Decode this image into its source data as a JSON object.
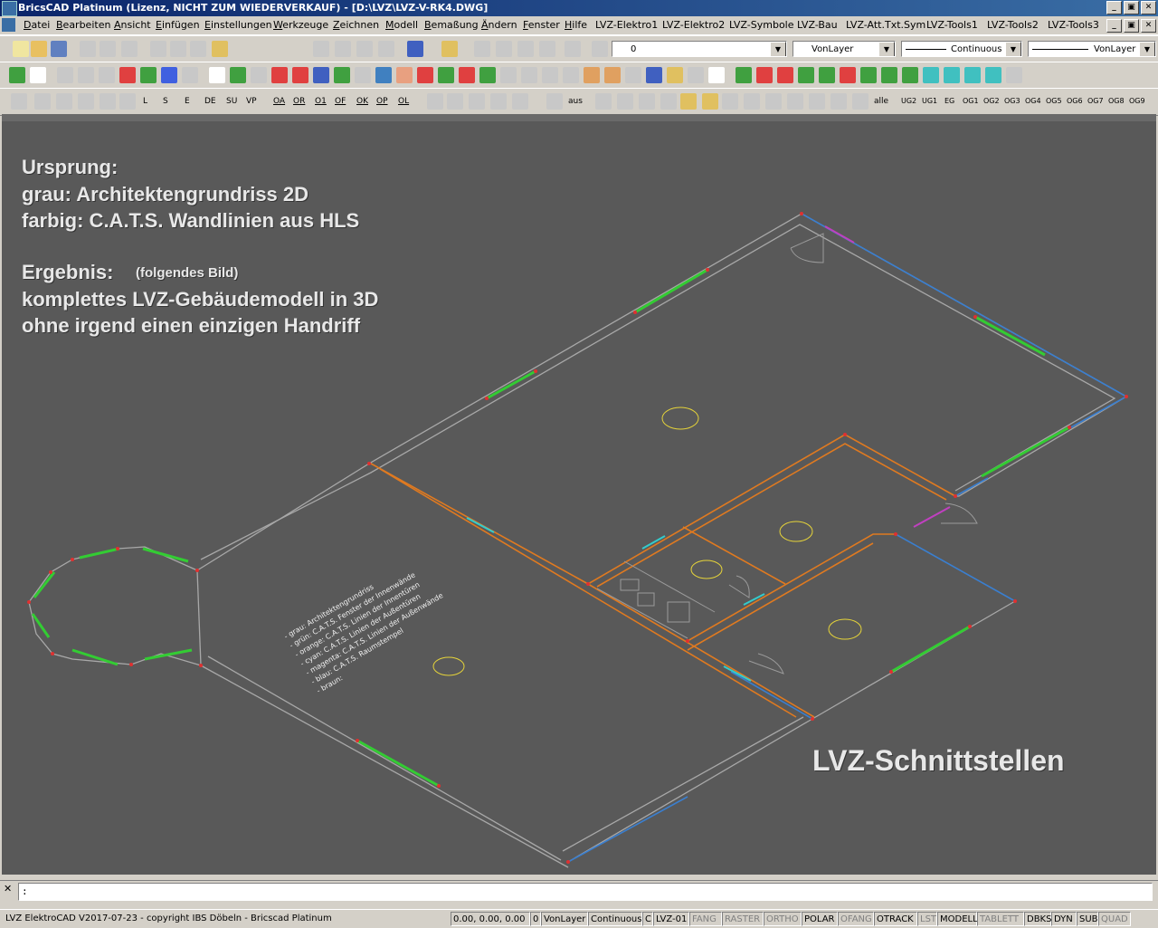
{
  "window": {
    "title": "BricsCAD Platinum (Lizenz, NICHT ZUM WIEDERVERKAUF) - [D:\\LVZ\\LVZ-V-RK4.DWG]"
  },
  "window_buttons": [
    "_",
    "▣",
    "✕"
  ],
  "menu": {
    "items": [
      {
        "u": "D",
        "rest": "atei"
      },
      {
        "u": "B",
        "rest": "earbeiten"
      },
      {
        "u": "A",
        "rest": "nsicht"
      },
      {
        "u": "E",
        "rest": "infügen"
      },
      {
        "u": "E",
        "rest": "instellungen"
      },
      {
        "u": "W",
        "rest": "erkzeuge"
      },
      {
        "u": "Z",
        "rest": "eichnen"
      },
      {
        "u": "M",
        "rest": "odell"
      },
      {
        "u": "B",
        "rest": "emaßung"
      },
      {
        "u": "Ä",
        "rest": "ndern"
      },
      {
        "u": "F",
        "rest": "enster"
      },
      {
        "u": "H",
        "rest": "ilfe"
      },
      {
        "u": "",
        "rest": "LVZ-Elektro1"
      },
      {
        "u": "",
        "rest": "LVZ-Elektro2"
      },
      {
        "u": "",
        "rest": "LVZ-Symbole"
      },
      {
        "u": "",
        "rest": "LVZ-Bau"
      },
      {
        "u": "",
        "rest": "LVZ-Att.Txt.Sym"
      },
      {
        "u": "",
        "rest": "LVZ-Tools1"
      },
      {
        "u": "",
        "rest": "LVZ-Tools2"
      },
      {
        "u": "",
        "rest": "LVZ-Tools3"
      }
    ]
  },
  "toolbar1": {
    "layer_value": "0",
    "color_value": "VonLayer",
    "linetype_value": "Continuous",
    "lineweight_value": "VonLayer"
  },
  "toolbar3": {
    "labels_a": [
      "L",
      "S",
      "E",
      "DE",
      "SU",
      "VP"
    ],
    "labels_b": [
      "OA",
      "OR",
      "O1",
      "OF",
      "OK",
      "OP",
      "OL"
    ],
    "labels_c": [
      "aus"
    ],
    "labels_d": [
      "alle"
    ],
    "floors": [
      "UG2",
      "UG1",
      "EG",
      "OG1",
      "OG2",
      "OG3",
      "OG4",
      "OG5",
      "OG6",
      "OG7",
      "OG8",
      "OG9"
    ]
  },
  "overlay": {
    "line1": "Ursprung:",
    "line2": "grau:    Architektengrundriss 2D",
    "line3": "farbig: C.A.T.S. Wandlinien aus HLS",
    "line4": "Ergebnis:",
    "line4b": "(folgendes Bild)",
    "line5": "komplettes LVZ-Gebäudemodell in 3D",
    "line6": "ohne irgend einen einzigen Handriff",
    "footer": "LVZ-Schnittstellen"
  },
  "drawing_legend": [
    "- grau:      Architektengrundriss",
    "- grün:      C.A.T.S. Fenster der Innenwände",
    "- orange:   C.A.T.S. Linien der Innentüren",
    "- cyan:      C.A.T.S. Linien der Außentüren",
    "- magenta:  C.A.T.S. Linien der Außenwände",
    "- blau:      C.A.T.S. Raumstempel",
    "- braun:    "
  ],
  "colors": {
    "canvas": "#595959",
    "wall_gray": "#a8a8a8",
    "window_green": "#33cc33",
    "inner_wall_orange": "#e07a20",
    "door_cyan": "#33cccc",
    "outer_wall_blue": "#3a7fd0",
    "magenta": "#c040c0",
    "stamp_yellow": "#e6d43a",
    "vertex_red": "#e03030"
  },
  "command": {
    "prompt": ":"
  },
  "status": {
    "left": "LVZ ElektroCAD V2017-07-23 - copyright IBS Döbeln - Bricscad Platinum",
    "coords": "0.00, 0.00, 0.00",
    "layer": "0",
    "color": "VonLayer",
    "linetype": "Continuous",
    "c": "C",
    "scale": "LVZ-01",
    "toggles": [
      "FANG",
      "RASTER",
      "ORTHO",
      "POLAR",
      "OFANG",
      "OTRACK",
      "LST",
      "MODELL",
      "TABLETT",
      "DBKS",
      "DYN",
      "SUB",
      "QUAD"
    ]
  }
}
